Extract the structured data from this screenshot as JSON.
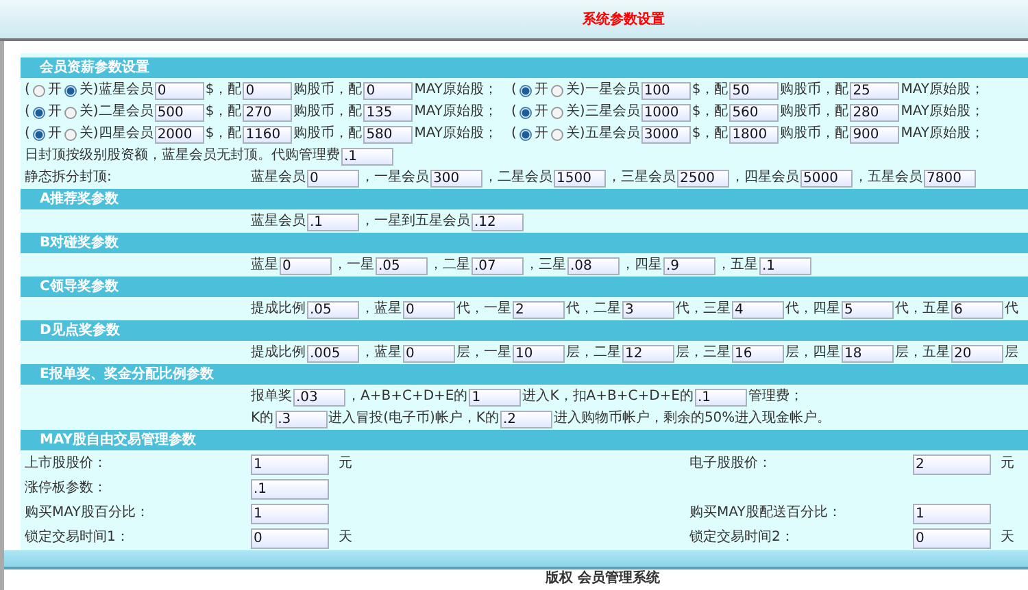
{
  "title": "系统参数设置",
  "sections": [
    {
      "heading": "会员资薪参数设置",
      "rows": [
        {
          "kind": "pair",
          "groups": [
            [
              {
                "kind": "toggle",
                "before": "(",
                "on_label": "开",
                "off_label": "关",
                "after": ")",
                "on": false
              },
              {
                "kind": "text",
                "text": "蓝星会员"
              },
              {
                "kind": "field",
                "value": "0"
              },
              {
                "kind": "text",
                "text": "$，配"
              },
              {
                "kind": "field",
                "value": "0"
              },
              {
                "kind": "text",
                "text": "购股币，配"
              },
              {
                "kind": "field",
                "value": "0"
              },
              {
                "kind": "text",
                "text": "MAY原始股；"
              }
            ],
            [
              {
                "kind": "toggle",
                "before": "(",
                "on_label": "开",
                "off_label": "关",
                "after": ")",
                "on": true
              },
              {
                "kind": "text",
                "text": "一星会员"
              },
              {
                "kind": "field",
                "value": "100"
              },
              {
                "kind": "text",
                "text": "$，配"
              },
              {
                "kind": "field",
                "value": "50"
              },
              {
                "kind": "text",
                "text": "购股币，配"
              },
              {
                "kind": "field",
                "value": "25"
              },
              {
                "kind": "text",
                "text": "MAY原始股；"
              }
            ]
          ]
        },
        {
          "kind": "pair",
          "groups": [
            [
              {
                "kind": "toggle",
                "before": "(",
                "on_label": "开",
                "off_label": "关",
                "after": ")",
                "on": true
              },
              {
                "kind": "text",
                "text": "二星会员"
              },
              {
                "kind": "field",
                "value": "500"
              },
              {
                "kind": "text",
                "text": "$，配"
              },
              {
                "kind": "field",
                "value": "270"
              },
              {
                "kind": "text",
                "text": "购股币，配"
              },
              {
                "kind": "field",
                "value": "135"
              },
              {
                "kind": "text",
                "text": "MAY原始股；"
              }
            ],
            [
              {
                "kind": "toggle",
                "before": "(",
                "on_label": "开",
                "off_label": "关",
                "after": ")",
                "on": true
              },
              {
                "kind": "text",
                "text": "三星会员"
              },
              {
                "kind": "field",
                "value": "1000"
              },
              {
                "kind": "text",
                "text": "$，配"
              },
              {
                "kind": "field",
                "value": "560"
              },
              {
                "kind": "text",
                "text": "购股币，配"
              },
              {
                "kind": "field",
                "value": "280"
              },
              {
                "kind": "text",
                "text": "MAY原始股；"
              }
            ]
          ]
        },
        {
          "kind": "pair",
          "groups": [
            [
              {
                "kind": "toggle",
                "before": "(",
                "on_label": "开",
                "off_label": "关",
                "after": ")",
                "on": true
              },
              {
                "kind": "text",
                "text": "四星会员"
              },
              {
                "kind": "field",
                "value": "2000"
              },
              {
                "kind": "text",
                "text": "$，配"
              },
              {
                "kind": "field",
                "value": "1160"
              },
              {
                "kind": "text",
                "text": "购股币，配"
              },
              {
                "kind": "field",
                "value": "580"
              },
              {
                "kind": "text",
                "text": "MAY原始股；"
              }
            ],
            [
              {
                "kind": "toggle",
                "before": "(",
                "on_label": "开",
                "off_label": "关",
                "after": ")",
                "on": true
              },
              {
                "kind": "text",
                "text": "五星会员"
              },
              {
                "kind": "field",
                "value": "3000"
              },
              {
                "kind": "text",
                "text": "$，配"
              },
              {
                "kind": "field",
                "value": "1800"
              },
              {
                "kind": "text",
                "text": "购股币，配"
              },
              {
                "kind": "field",
                "value": "900"
              },
              {
                "kind": "text",
                "text": "MAY原始股；"
              }
            ]
          ]
        },
        {
          "kind": "flow",
          "items": [
            {
              "kind": "text",
              "text": "日封顶按级别股资额，蓝星会员无封顶。代购管理费"
            },
            {
              "kind": "field",
              "value": ".1"
            }
          ]
        },
        {
          "kind": "labeled",
          "label": "静态拆分封顶:",
          "items": [
            {
              "kind": "text",
              "text": "蓝星会员"
            },
            {
              "kind": "field",
              "value": "0"
            },
            {
              "kind": "text",
              "text": "，"
            },
            {
              "kind": "text",
              "text": "一星会员"
            },
            {
              "kind": "field",
              "value": "300"
            },
            {
              "kind": "text",
              "text": "，"
            },
            {
              "kind": "text",
              "text": "二星会员"
            },
            {
              "kind": "field",
              "value": "1500"
            },
            {
              "kind": "text",
              "text": "，"
            },
            {
              "kind": "text",
              "text": "三星会员"
            },
            {
              "kind": "field",
              "value": "2500"
            },
            {
              "kind": "text",
              "text": "，"
            },
            {
              "kind": "text",
              "text": "四星会员"
            },
            {
              "kind": "field",
              "value": "5000"
            },
            {
              "kind": "text",
              "text": "，"
            },
            {
              "kind": "text",
              "text": "五星会员"
            },
            {
              "kind": "field",
              "value": "7800"
            }
          ]
        }
      ]
    },
    {
      "heading": "A推荐奖参数",
      "rows": [
        {
          "kind": "labeled",
          "items": [
            {
              "kind": "text",
              "text": "蓝星会员"
            },
            {
              "kind": "field",
              "value": ".1"
            },
            {
              "kind": "text",
              "text": "，"
            },
            {
              "kind": "text",
              "text": "一星到五星会员"
            },
            {
              "kind": "field",
              "value": ".12"
            }
          ]
        }
      ]
    },
    {
      "heading": "B对碰奖参数",
      "rows": [
        {
          "kind": "labeled",
          "items": [
            {
              "kind": "text",
              "text": "蓝星"
            },
            {
              "kind": "field",
              "value": "0"
            },
            {
              "kind": "text",
              "text": "，"
            },
            {
              "kind": "text",
              "text": "一星"
            },
            {
              "kind": "field",
              "value": ".05"
            },
            {
              "kind": "text",
              "text": "，"
            },
            {
              "kind": "text",
              "text": "二星"
            },
            {
              "kind": "field",
              "value": ".07"
            },
            {
              "kind": "text",
              "text": "，"
            },
            {
              "kind": "text",
              "text": "三星"
            },
            {
              "kind": "field",
              "value": ".08"
            },
            {
              "kind": "text",
              "text": "，"
            },
            {
              "kind": "text",
              "text": "四星"
            },
            {
              "kind": "field",
              "value": ".9"
            },
            {
              "kind": "text",
              "text": "，"
            },
            {
              "kind": "text",
              "text": "五星"
            },
            {
              "kind": "field",
              "value": ".1"
            }
          ]
        }
      ]
    },
    {
      "heading": "C领导奖参数",
      "rows": [
        {
          "kind": "labeled",
          "items": [
            {
              "kind": "text",
              "text": "提成比例"
            },
            {
              "kind": "field",
              "value": ".05"
            },
            {
              "kind": "text",
              "text": "，"
            },
            {
              "kind": "text",
              "text": "蓝星"
            },
            {
              "kind": "field",
              "value": "0"
            },
            {
              "kind": "text",
              "text": "代，"
            },
            {
              "kind": "text",
              "text": "一星"
            },
            {
              "kind": "field",
              "value": "2"
            },
            {
              "kind": "text",
              "text": "代，"
            },
            {
              "kind": "text",
              "text": "二星"
            },
            {
              "kind": "field",
              "value": "3"
            },
            {
              "kind": "text",
              "text": "代，"
            },
            {
              "kind": "text",
              "text": "三星"
            },
            {
              "kind": "field",
              "value": "4"
            },
            {
              "kind": "text",
              "text": "代，"
            },
            {
              "kind": "text",
              "text": "四星"
            },
            {
              "kind": "field",
              "value": "5"
            },
            {
              "kind": "text",
              "text": "代，"
            },
            {
              "kind": "text",
              "text": "五星"
            },
            {
              "kind": "field",
              "value": "6"
            },
            {
              "kind": "text",
              "text": "代"
            }
          ]
        }
      ]
    },
    {
      "heading": "D见点奖参数",
      "rows": [
        {
          "kind": "labeled",
          "items": [
            {
              "kind": "text",
              "text": "提成比例"
            },
            {
              "kind": "field",
              "value": ".005"
            },
            {
              "kind": "text",
              "text": "，"
            },
            {
              "kind": "text",
              "text": "蓝星"
            },
            {
              "kind": "field",
              "value": "0"
            },
            {
              "kind": "text",
              "text": "层，"
            },
            {
              "kind": "text",
              "text": "一星"
            },
            {
              "kind": "field",
              "value": "10"
            },
            {
              "kind": "text",
              "text": "层，"
            },
            {
              "kind": "text",
              "text": "二星"
            },
            {
              "kind": "field",
              "value": "12"
            },
            {
              "kind": "text",
              "text": "层，"
            },
            {
              "kind": "text",
              "text": "三星"
            },
            {
              "kind": "field",
              "value": "16"
            },
            {
              "kind": "text",
              "text": "层，"
            },
            {
              "kind": "text",
              "text": "四星"
            },
            {
              "kind": "field",
              "value": "18"
            },
            {
              "kind": "text",
              "text": "层，"
            },
            {
              "kind": "text",
              "text": "五星"
            },
            {
              "kind": "field",
              "value": "20"
            },
            {
              "kind": "text",
              "text": "层"
            }
          ]
        }
      ]
    },
    {
      "heading": "E报单奖、奖金分配比例参数",
      "rows": [
        {
          "kind": "labeled",
          "items": [
            {
              "kind": "text",
              "text": "报单奖"
            },
            {
              "kind": "field",
              "value": ".03"
            },
            {
              "kind": "text",
              "text": "，"
            },
            {
              "kind": "text",
              "text": "A+B+C+D+E的"
            },
            {
              "kind": "field",
              "value": "1"
            },
            {
              "kind": "text",
              "text": "进入K，"
            },
            {
              "kind": "text",
              "text": "扣A+B+C+D+E的"
            },
            {
              "kind": "field",
              "value": ".1"
            },
            {
              "kind": "text",
              "text": "管理费；"
            }
          ]
        },
        {
          "kind": "labeled",
          "items": [
            {
              "kind": "text",
              "text": "K的"
            },
            {
              "kind": "field",
              "value": ".3"
            },
            {
              "kind": "text",
              "text": "进入冒投(电子币)帐户，"
            },
            {
              "kind": "text",
              "text": "K的"
            },
            {
              "kind": "field",
              "value": ".2"
            },
            {
              "kind": "text",
              "text": "进入购物币帐户，"
            },
            {
              "kind": "text",
              "text": "剩余的50%进入现金帐户。"
            }
          ]
        }
      ]
    },
    {
      "heading": "MAY股自由交易管理参数",
      "rows": [
        {
          "kind": "grid",
          "cells": [
            {
              "label": "上市股股价：",
              "value": "1",
              "unit": "元"
            },
            {
              "label": "电子股股价：",
              "value": "2",
              "unit": "元"
            }
          ]
        },
        {
          "kind": "grid",
          "cells": [
            {
              "label": "涨停板参数：",
              "value": ".1"
            }
          ]
        },
        {
          "kind": "grid",
          "cells": [
            {
              "label": "购买MAY股百分比：",
              "value": "1"
            },
            {
              "label": "购买MAY股配送百分比：",
              "value": "1"
            }
          ]
        },
        {
          "kind": "grid",
          "cells": [
            {
              "label": "锁定交易时间1：",
              "value": "0",
              "unit": "天"
            },
            {
              "label": "锁定交易时间2：",
              "value": "0",
              "unit": "天"
            }
          ]
        }
      ]
    }
  ],
  "footer": "版权  会员管理系统"
}
